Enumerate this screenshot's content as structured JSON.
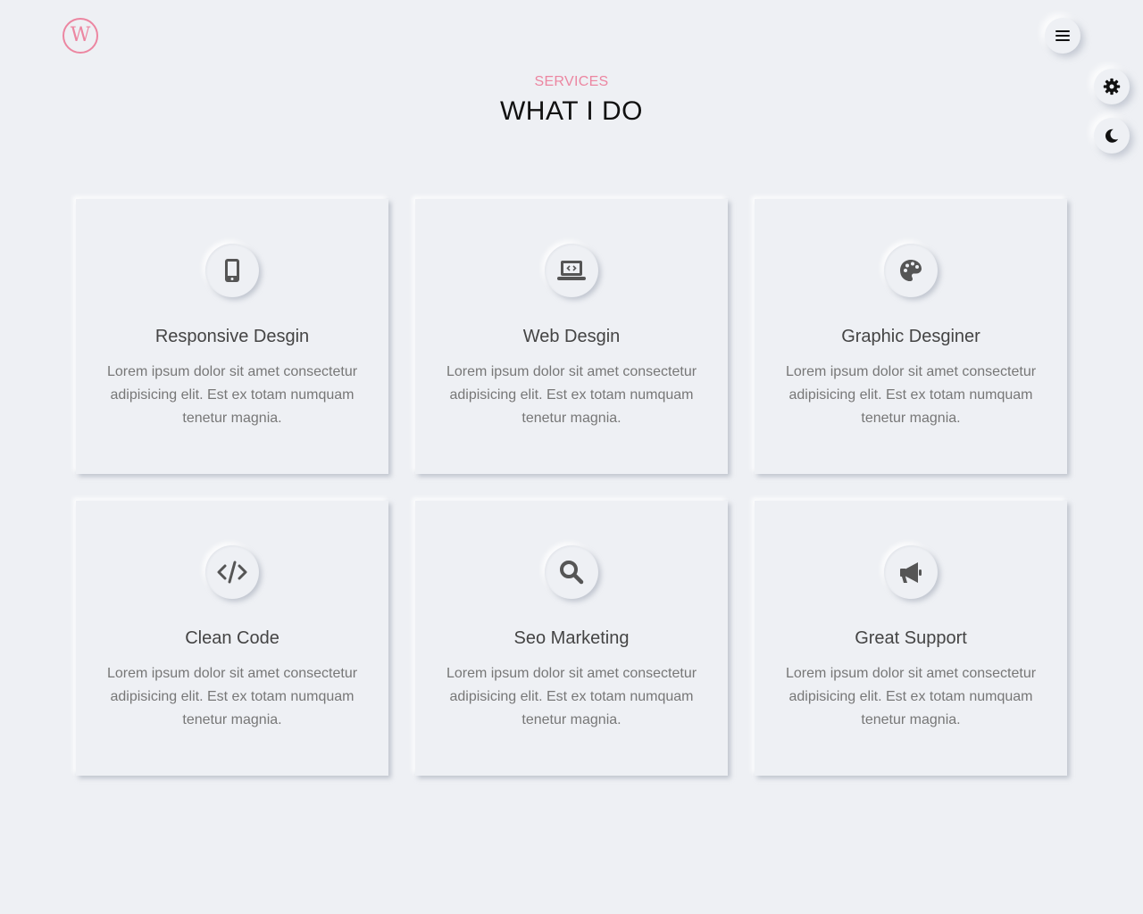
{
  "logo": {
    "letter": "W"
  },
  "header": {
    "subtitle": "SERVICES",
    "title": "WHAT I DO"
  },
  "colors": {
    "accent": "#ec86a1",
    "background": "#eef0f4",
    "icon": "#555555"
  },
  "icons": {
    "menu": "hamburger-icon",
    "settings": "gear-icon",
    "theme": "moon-icon"
  },
  "services": [
    {
      "icon": "mobile-icon",
      "title": "Responsive Desgin",
      "text": "Lorem ipsum dolor sit amet consectetur adipisicing elit. Est ex totam numquam tenetur magnia."
    },
    {
      "icon": "laptop-code-icon",
      "title": "Web Desgin",
      "text": "Lorem ipsum dolor sit amet consectetur adipisicing elit. Est ex totam numquam tenetur magnia."
    },
    {
      "icon": "palette-icon",
      "title": "Graphic Desginer",
      "text": "Lorem ipsum dolor sit amet consectetur adipisicing elit. Est ex totam numquam tenetur magnia."
    },
    {
      "icon": "code-icon",
      "title": "Clean Code",
      "text": "Lorem ipsum dolor sit amet consectetur adipisicing elit. Est ex totam numquam tenetur magnia."
    },
    {
      "icon": "search-icon",
      "title": "Seo Marketing",
      "text": "Lorem ipsum dolor sit amet consectetur adipisicing elit. Est ex totam numquam tenetur magnia."
    },
    {
      "icon": "megaphone-icon",
      "title": "Great Support",
      "text": "Lorem ipsum dolor sit amet consectetur adipisicing elit. Est ex totam numquam tenetur magnia."
    }
  ]
}
